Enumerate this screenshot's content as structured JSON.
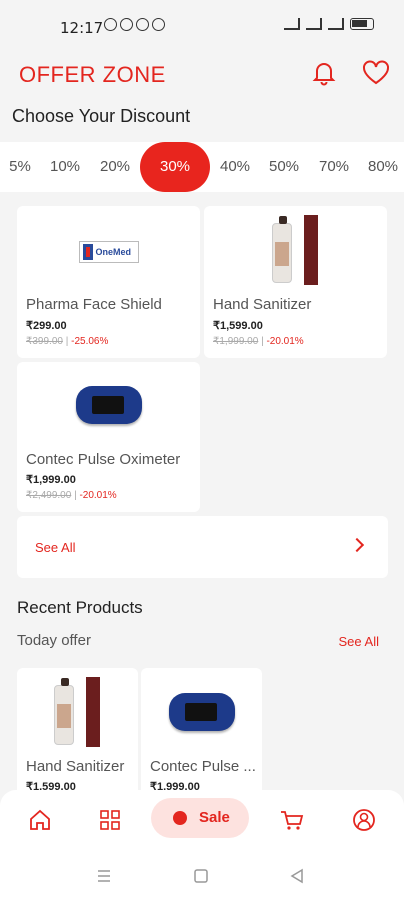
{
  "status_bar": {
    "time": "12:17"
  },
  "header": {
    "title": "OFFER ZONE"
  },
  "discount_section": {
    "title": "Choose Your Discount",
    "options": [
      "5%",
      "10%",
      "20%",
      "30%",
      "40%",
      "50%",
      "70%",
      "80%"
    ],
    "selected": "30%"
  },
  "products": [
    {
      "name": "Pharma Face Shield",
      "price": "₹299.00",
      "old_price": "₹399.00",
      "discount": "-25.06%",
      "image": "onemed-logo"
    },
    {
      "name": "Hand Sanitizer",
      "price": "₹1,599.00",
      "old_price": "₹1,999.00",
      "discount": "-20.01%",
      "image": "sanitizer-bottle"
    },
    {
      "name": "Contec Pulse Oximeter",
      "price": "₹1,999.00",
      "old_price": "₹2,499.00",
      "discount": "-20.01%",
      "image": "pulse-oximeter"
    }
  ],
  "see_all_card": {
    "label": "See All"
  },
  "recent": {
    "title": "Recent Products",
    "subtitle": "Today offer",
    "see_all": "See All",
    "items": [
      {
        "name": "Hand Sanitizer",
        "price": "₹1,599.00",
        "image": "sanitizer-bottle"
      },
      {
        "name": "Contec Pulse ...",
        "price": "₹1,999.00",
        "image": "pulse-oximeter"
      }
    ]
  },
  "bottom_nav": {
    "items": [
      "home-icon",
      "categories-icon",
      "sale",
      "cart-icon",
      "profile-icon"
    ],
    "sale_label": "Sale",
    "accent": "#e3261f"
  },
  "colors": {
    "accent": "#e3261f",
    "background": "#f4f4f4"
  }
}
